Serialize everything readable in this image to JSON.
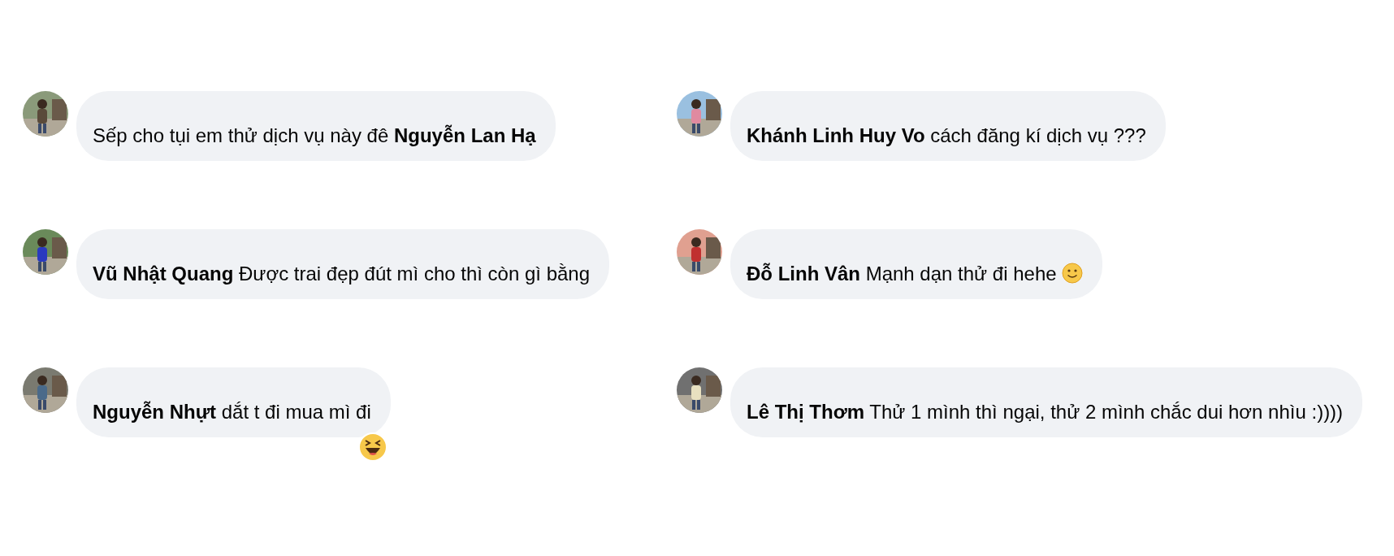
{
  "columns": [
    {
      "comments": [
        {
          "kind": "plain",
          "text": "Sếp cho tụi em thử dịch vụ này đê **Nguyễn Lan Hạ**"
        },
        {
          "kind": "plain",
          "text": "**Vũ Nhật Quang** Được trai đẹp đút mì cho thì còn gì bằng"
        },
        {
          "kind": "reacted",
          "text": "**Nguyễn Nhựt** dắt t đi mua mì đi"
        }
      ]
    },
    {
      "comments": [
        {
          "kind": "plain",
          "text": "**Khánh Linh Huy Vo** cách đăng kí dịch vụ ???"
        },
        {
          "kind": "smiley",
          "text": "**Đỗ Linh Vân** Mạnh dạn thử đi hehe"
        },
        {
          "kind": "plain",
          "text": "**Lê Thị Thơm** Thử 1 mình thì ngại, thử 2 mình chắc dui hơn nhìu :))))"
        }
      ]
    }
  ]
}
